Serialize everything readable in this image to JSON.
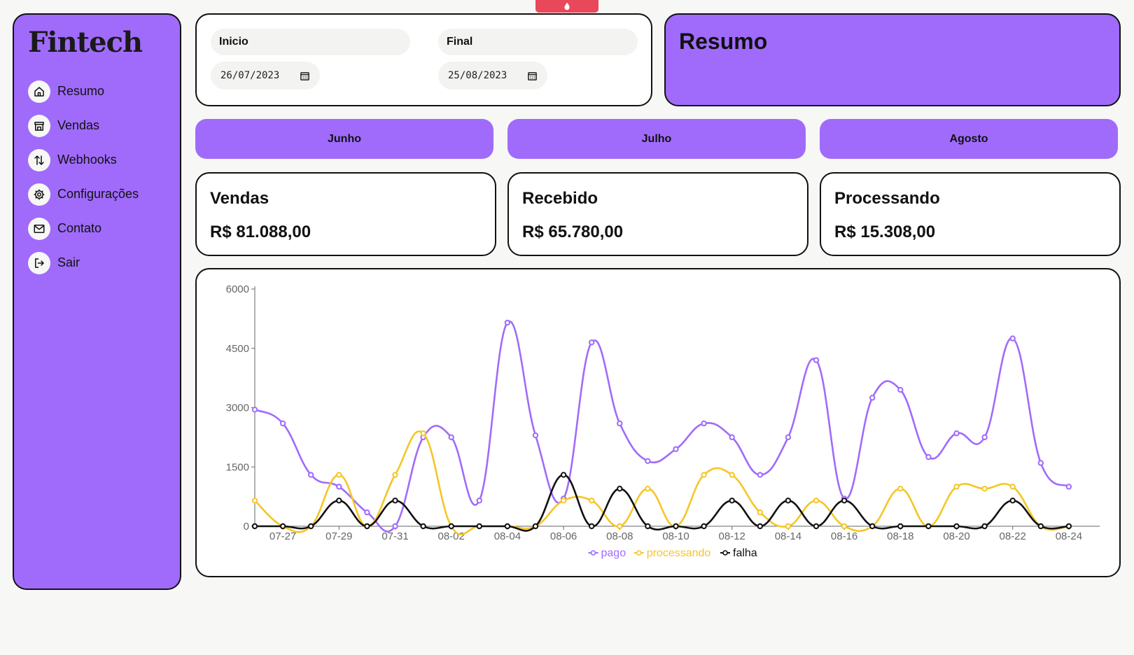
{
  "app": {
    "brand": "Fintech"
  },
  "sidebar": {
    "items": [
      {
        "label": "Resumo",
        "icon": "home-icon"
      },
      {
        "label": "Vendas",
        "icon": "store-icon"
      },
      {
        "label": "Webhooks",
        "icon": "arrows-up-down-icon"
      },
      {
        "label": "Configurações",
        "icon": "gear-icon"
      },
      {
        "label": "Contato",
        "icon": "mail-icon"
      },
      {
        "label": "Sair",
        "icon": "logout-icon"
      }
    ]
  },
  "filters": {
    "start_label": "Inicio",
    "start_value": "26/07/2023",
    "end_label": "Final",
    "end_value": "25/08/2023"
  },
  "summary": {
    "title": "Resumo"
  },
  "months": [
    "Junho",
    "Julho",
    "Agosto"
  ],
  "stats": [
    {
      "title": "Vendas",
      "value": "R$ 81.088,00"
    },
    {
      "title": "Recebido",
      "value": "R$ 65.780,00"
    },
    {
      "title": "Processando",
      "value": "R$ 15.308,00"
    }
  ],
  "colors": {
    "accent": "#a06bfb",
    "pago": "#a06bfb",
    "processando": "#f5c626",
    "falha": "#111111",
    "top_pill": "#e8485a"
  },
  "chart_data": {
    "type": "line",
    "x": [
      "07-26",
      "07-27",
      "07-28",
      "07-29",
      "07-30",
      "07-31",
      "08-01",
      "08-02",
      "08-03",
      "08-04",
      "08-05",
      "08-06",
      "08-07",
      "08-08",
      "08-09",
      "08-10",
      "08-11",
      "08-12",
      "08-13",
      "08-14",
      "08-15",
      "08-16",
      "08-17",
      "08-18",
      "08-19",
      "08-20",
      "08-21",
      "08-22",
      "08-23",
      "08-24",
      "08-25"
    ],
    "xtick_labels": [
      "07-27",
      "07-29",
      "07-31",
      "08-02",
      "08-04",
      "08-06",
      "08-08",
      "08-10",
      "08-12",
      "08-14",
      "08-16",
      "08-18",
      "08-20",
      "08-22",
      "08-24"
    ],
    "yticks": [
      0,
      1500,
      3000,
      4500,
      6000
    ],
    "ylim": [
      0,
      6000
    ],
    "legend_position": "bottom",
    "grid": false,
    "series": [
      {
        "name": "pago",
        "color": "#a06bfb",
        "values": [
          2950,
          2600,
          1300,
          1000,
          350,
          0,
          2250,
          2250,
          650,
          5150,
          2300,
          700,
          4650,
          2600,
          1650,
          1950,
          2600,
          2250,
          1300,
          2250,
          4200,
          700,
          3250,
          3450,
          1750,
          2350,
          2250,
          4750,
          1600,
          1000,
          null
        ]
      },
      {
        "name": "processando",
        "color": "#f5c626",
        "values": [
          650,
          0,
          0,
          1300,
          0,
          1300,
          2350,
          0,
          0,
          0,
          0,
          650,
          650,
          0,
          950,
          0,
          1300,
          1300,
          350,
          0,
          650,
          0,
          0,
          950,
          0,
          1000,
          950,
          1000,
          0,
          0,
          null
        ]
      },
      {
        "name": "falha",
        "color": "#111111",
        "values": [
          0,
          0,
          0,
          650,
          0,
          650,
          0,
          0,
          0,
          0,
          0,
          1300,
          0,
          950,
          0,
          0,
          0,
          650,
          0,
          650,
          0,
          650,
          0,
          0,
          0,
          0,
          0,
          650,
          0,
          0,
          null
        ]
      }
    ]
  }
}
